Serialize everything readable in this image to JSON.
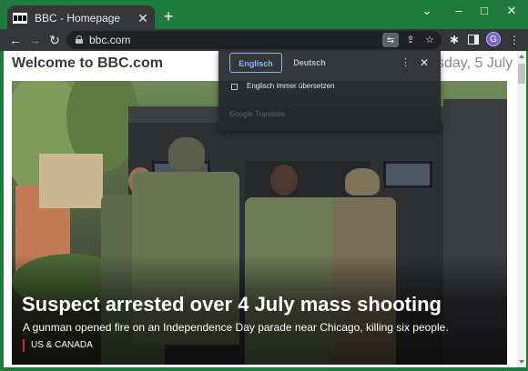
{
  "browser": {
    "tab": {
      "title": "BBC - Homepage"
    },
    "new_tab": "+",
    "window": {
      "minimize": "–",
      "maximize": "□",
      "close": "✕",
      "dropdown": "⌄"
    },
    "address_bar": {
      "url": "bbc.com",
      "translate_glyph": "⇆"
    },
    "profile_initial": "G",
    "icons": [
      "back-arrow-icon",
      "forward-arrow-icon",
      "reload-icon",
      "lock-icon",
      "translate-icon",
      "share-icon",
      "star-icon",
      "extensions-icon",
      "side-panel-icon",
      "menu-icon"
    ]
  },
  "page": {
    "welcome": "Welcome to BBC.com",
    "date": "sday, 5 July",
    "hero": {
      "headline": "Suspect arrested over 4 July mass shooting",
      "summary": "A gunman opened fire on an Independence Day parade near Chicago, killing six people.",
      "section": "US & CANADA"
    }
  },
  "translate_popup": {
    "tabs": [
      {
        "label": "Englisch",
        "active": true
      },
      {
        "label": "Deutsch",
        "active": false
      }
    ],
    "always_translate": {
      "label": "Englisch immer übersetzen",
      "checked": false
    },
    "footer": "Google Translate"
  },
  "colors": {
    "frame": "#1f7a3d",
    "toolbar": "#35363a",
    "active_lang": "#8ab4f8",
    "section_accent": "#d6262c"
  }
}
